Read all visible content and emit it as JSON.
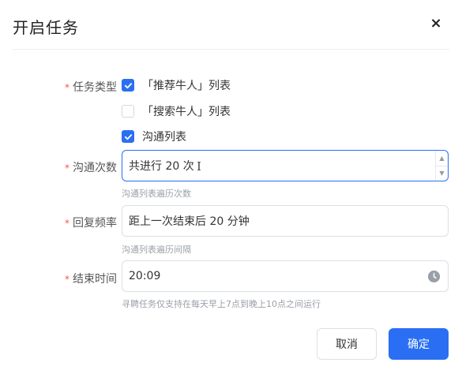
{
  "dialog": {
    "title": "开启任务",
    "close_glyph": "×"
  },
  "task_type": {
    "required_mark": "*",
    "label": "任务类型",
    "options": [
      {
        "label": "「推荐牛人」列表",
        "checked": true
      },
      {
        "label": "「搜索牛人」列表",
        "checked": false
      },
      {
        "label": "沟通列表",
        "checked": true
      }
    ]
  },
  "contact_count": {
    "required_mark": "*",
    "label": "沟通次数",
    "value": "共进行 20 次",
    "hint": "沟通列表遍历次数",
    "spinner_up": "▲",
    "spinner_down": "▼"
  },
  "reply_frequency": {
    "required_mark": "*",
    "label": "回复频率",
    "value": "距上一次结束后 20 分钟",
    "hint": "沟通列表遍历间隔"
  },
  "end_time": {
    "required_mark": "*",
    "label": "结束时间",
    "value": "20:09",
    "hint": "寻聘任务仅支持在每天早上7点到晚上10点之间运行",
    "icon": "clock-icon"
  },
  "footer": {
    "cancel_label": "取消",
    "confirm_label": "确定"
  },
  "colors": {
    "accent": "#2a6ff3",
    "required": "#f5564a"
  }
}
